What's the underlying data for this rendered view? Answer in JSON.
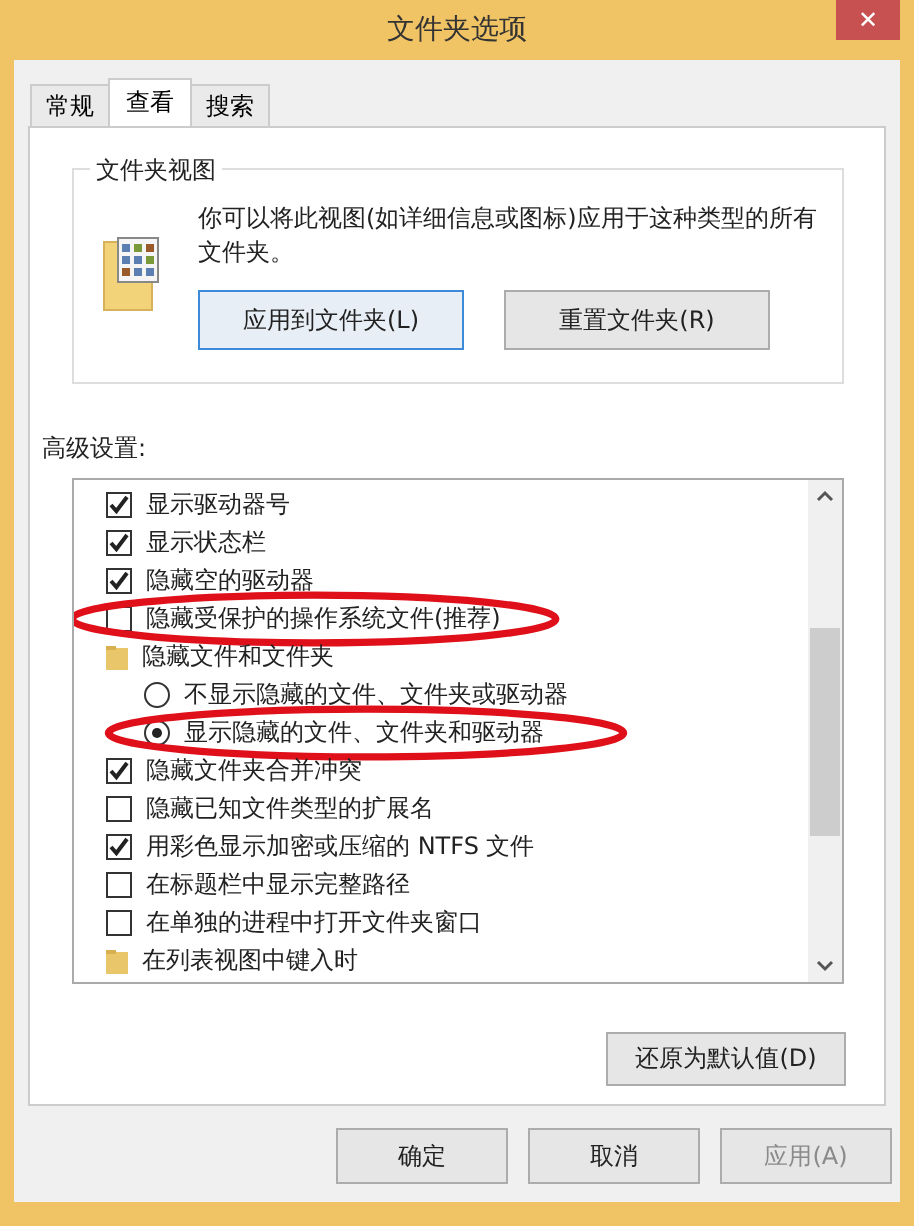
{
  "window": {
    "title": "文件夹选项",
    "close": "✕"
  },
  "tabs": [
    {
      "label": "常规",
      "selected": false
    },
    {
      "label": "查看",
      "selected": true
    },
    {
      "label": "搜索",
      "selected": false
    }
  ],
  "folder_views": {
    "title": "文件夹视图",
    "description": "你可以将此视图(如详细信息或图标)应用于这种类型的所有文件夹。",
    "buttons": [
      {
        "label": "应用到文件夹(L)",
        "focused": true
      },
      {
        "label": "重置文件夹(R)",
        "focused": false
      }
    ]
  },
  "advanced": {
    "label": "高级设置:",
    "items": [
      {
        "kind": "checkbox",
        "label": "显示驱动器号",
        "checked": true,
        "circled": false
      },
      {
        "kind": "checkbox",
        "label": "显示状态栏",
        "checked": true,
        "circled": false
      },
      {
        "kind": "checkbox",
        "label": "隐藏空的驱动器",
        "checked": true,
        "circled": false
      },
      {
        "kind": "checkbox",
        "label": "隐藏受保护的操作系统文件(推荐)",
        "checked": false,
        "circled": true
      },
      {
        "kind": "folder",
        "label": "隐藏文件和文件夹",
        "children": [
          {
            "kind": "radio",
            "label": "不显示隐藏的文件、文件夹或驱动器",
            "selected": false,
            "circled": false
          },
          {
            "kind": "radio",
            "label": "显示隐藏的文件、文件夹和驱动器",
            "selected": true,
            "circled": true
          }
        ]
      },
      {
        "kind": "checkbox",
        "label": "隐藏文件夹合并冲突",
        "checked": true,
        "circled": false
      },
      {
        "kind": "checkbox",
        "label": "隐藏已知文件类型的扩展名",
        "checked": false,
        "circled": false
      },
      {
        "kind": "checkbox",
        "label": "用彩色显示加密或压缩的 NTFS 文件",
        "checked": true,
        "circled": false
      },
      {
        "kind": "checkbox",
        "label": "在标题栏中显示完整路径",
        "checked": false,
        "circled": false
      },
      {
        "kind": "checkbox",
        "label": "在单独的进程中打开文件夹窗口",
        "checked": false,
        "circled": false
      },
      {
        "kind": "folder",
        "label": "在列表视图中键入时"
      }
    ],
    "restore_button": "还原为默认值(D)"
  },
  "footer_buttons": [
    {
      "label": "确定",
      "disabled": false
    },
    {
      "label": "取消",
      "disabled": false
    },
    {
      "label": "应用(A)",
      "disabled": true
    }
  ]
}
